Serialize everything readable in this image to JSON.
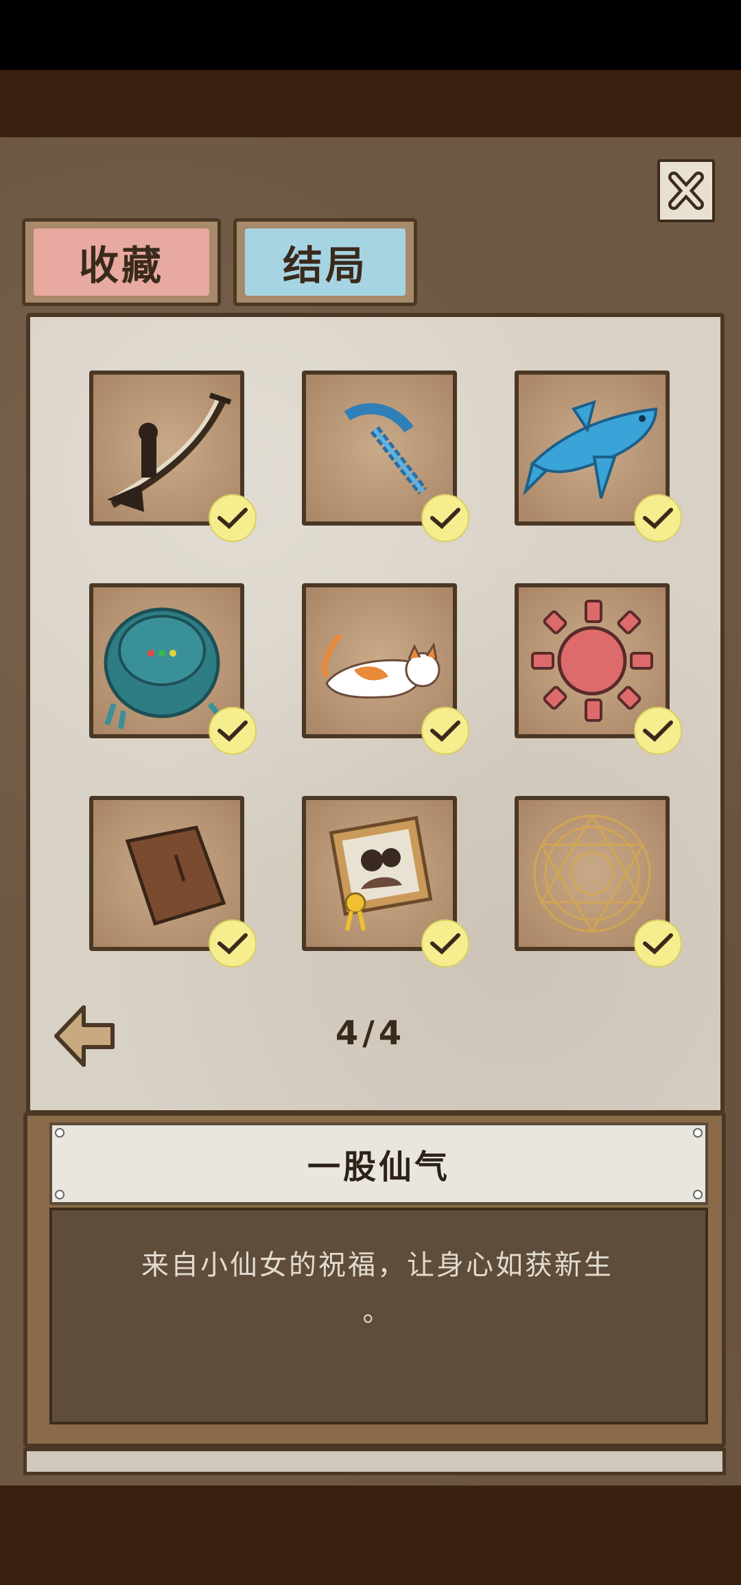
{
  "tabs": [
    {
      "label": "收藏"
    },
    {
      "label": "结局"
    }
  ],
  "close_icon": "close-icon",
  "items": [
    {
      "name": "bow-icon",
      "collected": true
    },
    {
      "name": "pickaxe-icon",
      "collected": true
    },
    {
      "name": "fish-icon",
      "collected": true
    },
    {
      "name": "robot-vacuum-icon",
      "collected": true
    },
    {
      "name": "cat-icon",
      "collected": true
    },
    {
      "name": "sun-icon",
      "collected": true
    },
    {
      "name": "door-icon",
      "collected": true
    },
    {
      "name": "certificate-photo-icon",
      "collected": true
    },
    {
      "name": "magic-circle-icon",
      "collected": true
    }
  ],
  "pager": {
    "page": "4/4",
    "prev_icon": "arrow-left-icon"
  },
  "description": {
    "title": "一股仙气",
    "text": "来自小仙女的祝福，让身心如获新生",
    "tail": "。"
  },
  "colors": {
    "tab_collect": "#e8a9a0",
    "tab_ending": "#a7d4e2",
    "check": "#f6ee8e",
    "frame": "#4a3724"
  }
}
